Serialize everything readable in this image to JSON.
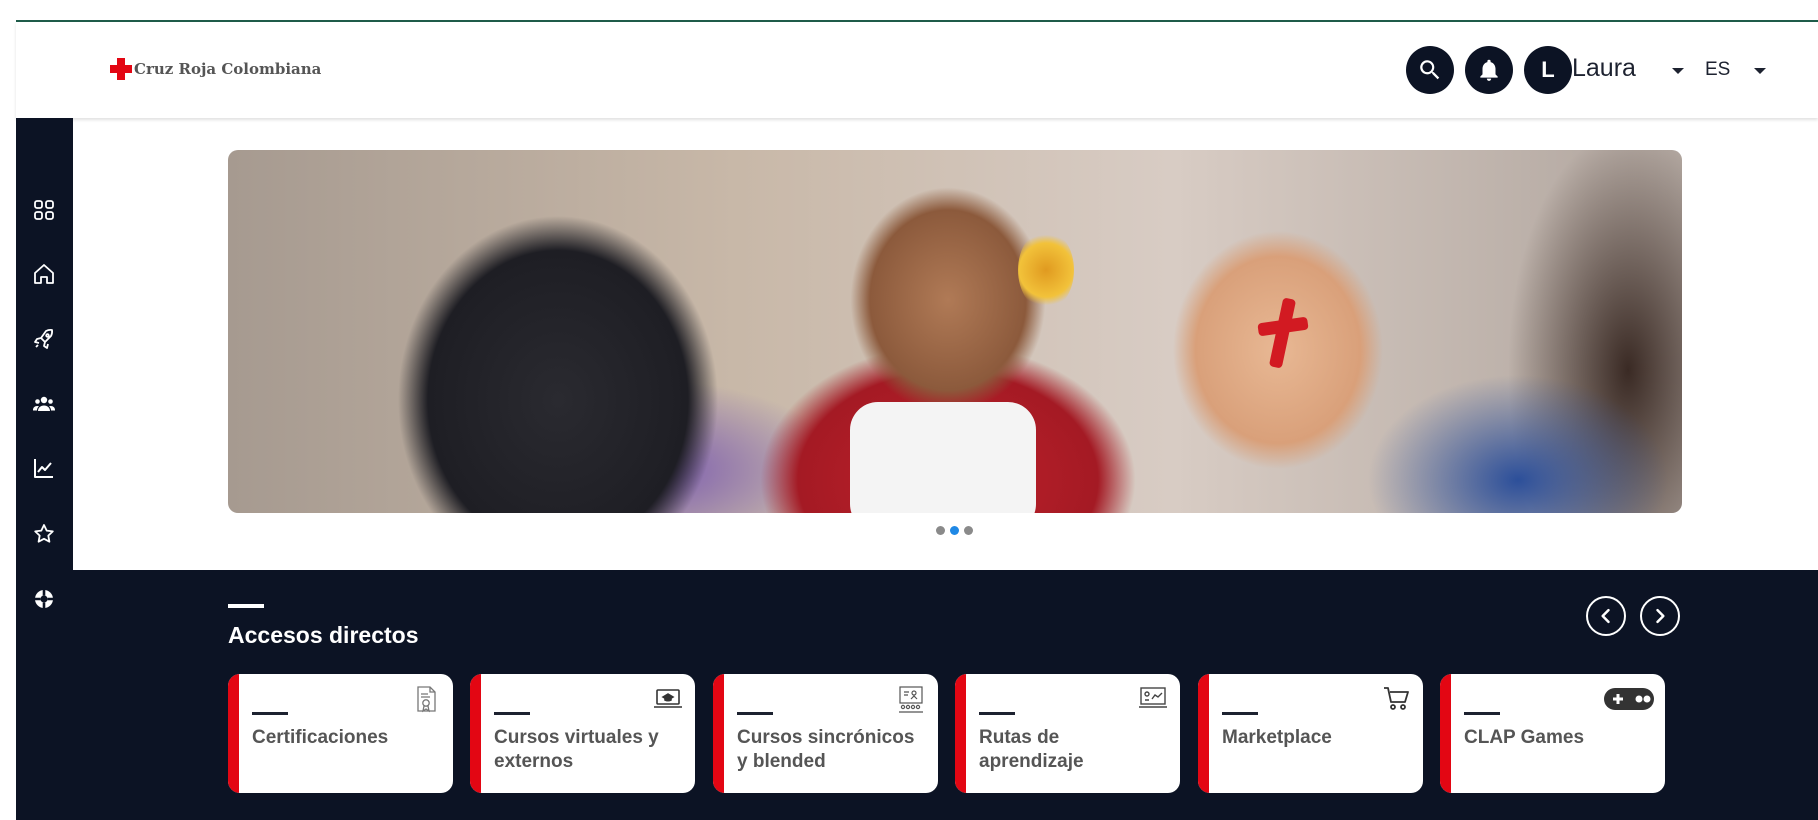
{
  "header": {
    "logo_text": "Cruz Roja Colombiana",
    "avatar_initial": "L",
    "user_name": "Laura",
    "language": "ES"
  },
  "sidebar": {
    "items": [
      {
        "icon": "grid-icon"
      },
      {
        "icon": "home-icon"
      },
      {
        "icon": "rocket-icon"
      },
      {
        "icon": "users-icon"
      },
      {
        "icon": "chart-icon"
      },
      {
        "icon": "star-icon"
      },
      {
        "icon": "lifebuoy-icon"
      }
    ]
  },
  "carousel": {
    "slide_count": 3,
    "active_index": 1
  },
  "quick_access": {
    "title": "Accesos directos",
    "cards": [
      {
        "label": "Certificaciones",
        "icon": "certificate-icon"
      },
      {
        "label": "Cursos virtuales y externos",
        "icon": "laptop-course-icon"
      },
      {
        "label": "Cursos sincrónicos y blended",
        "icon": "classroom-icon"
      },
      {
        "label": "Rutas de aprendizaje",
        "icon": "learning-path-icon"
      },
      {
        "label": "Marketplace",
        "icon": "cart-icon"
      },
      {
        "label": "CLAP Games",
        "icon": "gamepad-icon"
      }
    ]
  },
  "colors": {
    "navy": "#0c1324",
    "accent_red": "#e30613",
    "dot_active": "#1f88e5"
  }
}
